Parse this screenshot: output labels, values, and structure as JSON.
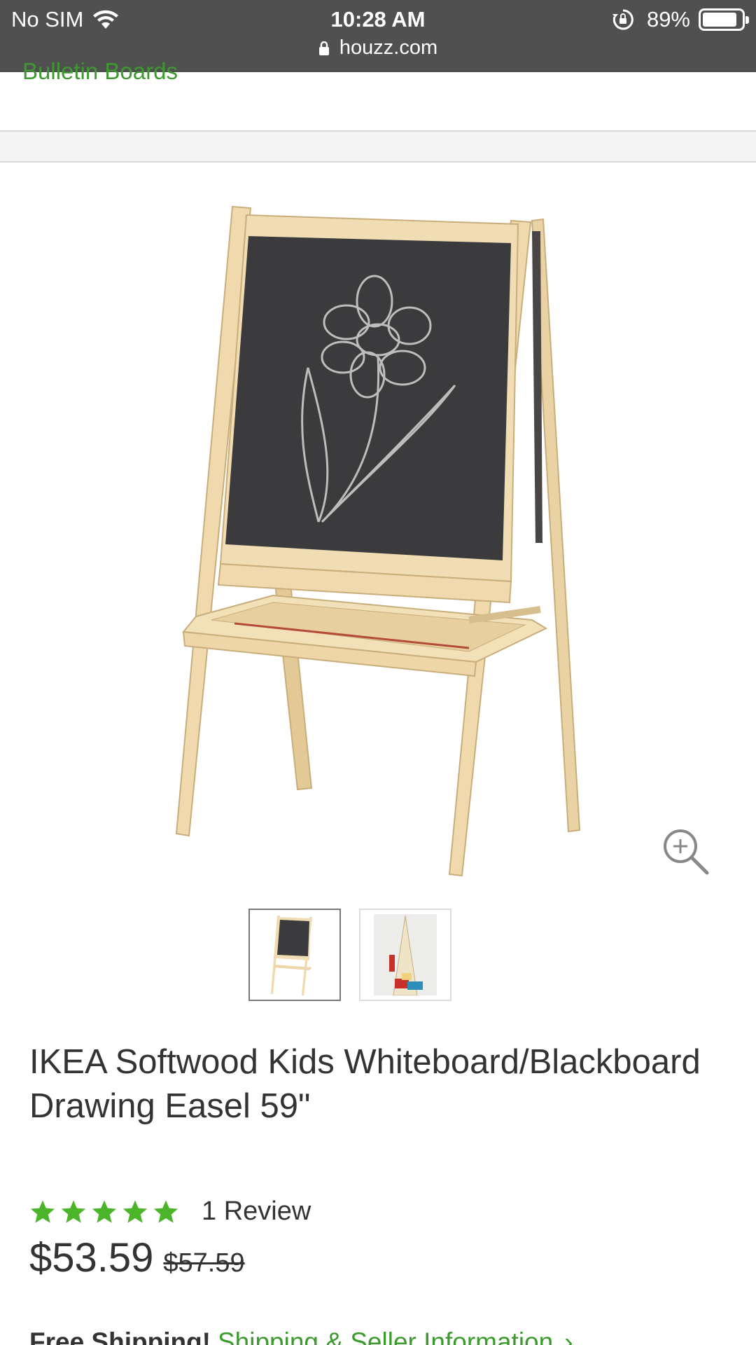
{
  "status_bar": {
    "carrier": "No SIM",
    "time": "10:28 AM",
    "battery": "89%",
    "battery_level": 0.89,
    "url": "houzz.com"
  },
  "breadcrumb": {
    "label": "Bulletin Boards"
  },
  "product": {
    "title": "IKEA Softwood Kids Whiteboard/Blackboard Drawing Easel 59\"",
    "rating": 5,
    "reviews_label": "1 Review",
    "price": "$53.59",
    "old_price": "$57.59",
    "thumbnails_count": 2
  },
  "shipping": {
    "label": "Free Shipping!",
    "link": "Shipping & Seller Information",
    "chevron": "›"
  },
  "colors": {
    "accent_green": "#3d9a2e",
    "star_green": "#4bb52a",
    "status_bar_bg": "#505050"
  },
  "icons": [
    "wifi-icon",
    "rotation-lock-icon",
    "battery-icon",
    "padlock-icon",
    "zoom-in-icon",
    "star-icon",
    "chevron-right-icon"
  ]
}
